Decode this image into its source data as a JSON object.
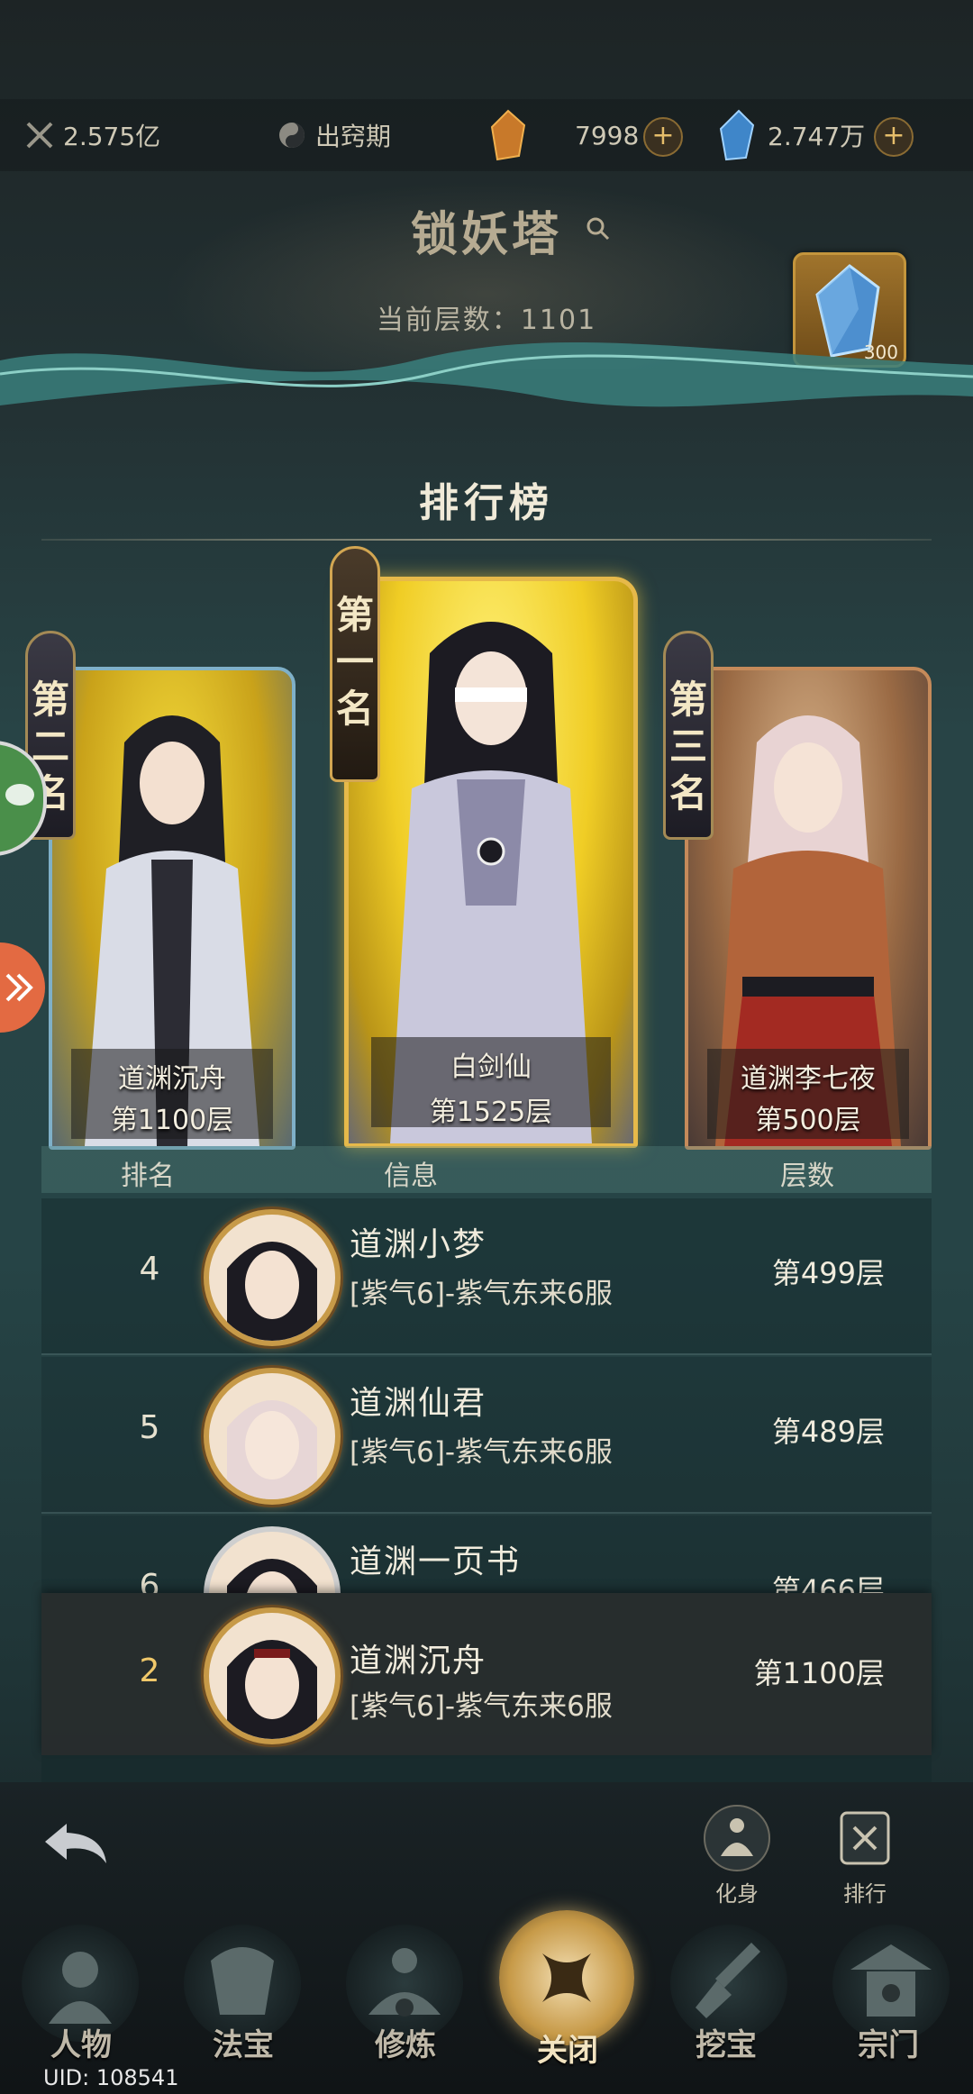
{
  "resources": {
    "power": "2.575亿",
    "stage": "出窍期",
    "ore": "7998",
    "crystal": "2.747万"
  },
  "header": {
    "title": "锁妖塔",
    "current_floor": "当前层数：1101",
    "crystal_count": "300"
  },
  "leaderboard": {
    "title": "排行榜",
    "podium": [
      {
        "rank_label": "第二名",
        "name": "道渊沉舟",
        "floor": "第1100层"
      },
      {
        "rank_label": "第一名",
        "name": "白剑仙",
        "floor": "第1525层"
      },
      {
        "rank_label": "第三名",
        "name": "道渊李七夜",
        "floor": "第500层"
      }
    ],
    "columns": {
      "rank": "排名",
      "info": "信息",
      "floors": "层数"
    },
    "rows": [
      {
        "rank": "4",
        "name": "道渊小梦",
        "desc": "[紫气6]-紫气东来6服",
        "floor": "第499层"
      },
      {
        "rank": "5",
        "name": "道渊仙君",
        "desc": "[紫气6]-紫气东来6服",
        "floor": "第489层"
      },
      {
        "rank": "6",
        "name": "道渊一页书",
        "desc": "",
        "floor": "第466层"
      }
    ],
    "self": {
      "rank": "2",
      "name": "道渊沉舟",
      "desc": "[紫气6]-紫气东来6服",
      "floor": "第1100层"
    }
  },
  "actions": {
    "avatar": "化身",
    "ranking": "排行"
  },
  "nav": [
    "人物",
    "法宝",
    "修炼",
    "关闭",
    "挖宝",
    "宗门"
  ],
  "uid": "UID: 108541",
  "colors": {
    "gold": "#c79a48",
    "teal": "#3a7f7c",
    "accent": "#e36a42"
  }
}
